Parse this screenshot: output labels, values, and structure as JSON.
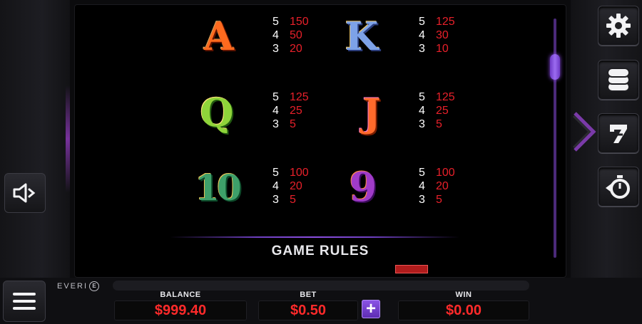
{
  "paytable": [
    {
      "symbol": "A",
      "symbol_name": "a-symbol-icon",
      "pays": [
        {
          "count": "5",
          "value": "150"
        },
        {
          "count": "4",
          "value": "50"
        },
        {
          "count": "3",
          "value": "20"
        }
      ]
    },
    {
      "symbol": "K",
      "symbol_name": "k-symbol-icon",
      "pays": [
        {
          "count": "5",
          "value": "125"
        },
        {
          "count": "4",
          "value": "30"
        },
        {
          "count": "3",
          "value": "10"
        }
      ]
    },
    {
      "symbol": "Q",
      "symbol_name": "q-symbol-icon",
      "pays": [
        {
          "count": "5",
          "value": "125"
        },
        {
          "count": "4",
          "value": "25"
        },
        {
          "count": "3",
          "value": "5"
        }
      ]
    },
    {
      "symbol": "J",
      "symbol_name": "j-symbol-icon",
      "pays": [
        {
          "count": "5",
          "value": "125"
        },
        {
          "count": "4",
          "value": "25"
        },
        {
          "count": "3",
          "value": "5"
        }
      ]
    },
    {
      "symbol": "10",
      "symbol_name": "ten-symbol-icon",
      "pays": [
        {
          "count": "5",
          "value": "100"
        },
        {
          "count": "4",
          "value": "20"
        },
        {
          "count": "3",
          "value": "5"
        }
      ]
    },
    {
      "symbol": "9",
      "symbol_name": "nine-symbol-icon",
      "pays": [
        {
          "count": "5",
          "value": "100"
        },
        {
          "count": "4",
          "value": "20"
        },
        {
          "count": "3",
          "value": "5"
        }
      ]
    }
  ],
  "section_title": "GAME RULES",
  "brand": {
    "text": "EVERI",
    "mark": "E"
  },
  "meters": {
    "balance_label": "BALANCE",
    "balance_value": "$999.40",
    "bet_label": "BET",
    "bet_value": "$0.50",
    "win_label": "WIN",
    "win_value": "$0.00",
    "bet_increase": "+"
  },
  "side_buttons": {
    "right": [
      "gear-icon",
      "coin-stack-icon",
      "slot-seven-icon",
      "autoplay-timer-icon"
    ],
    "left": [
      "speaker-icon",
      "hamburger-menu-icon"
    ]
  },
  "colors": {
    "accent": "#8d55e8",
    "meter_value": "#ff2a2a",
    "pay_value": "#e8202a"
  }
}
